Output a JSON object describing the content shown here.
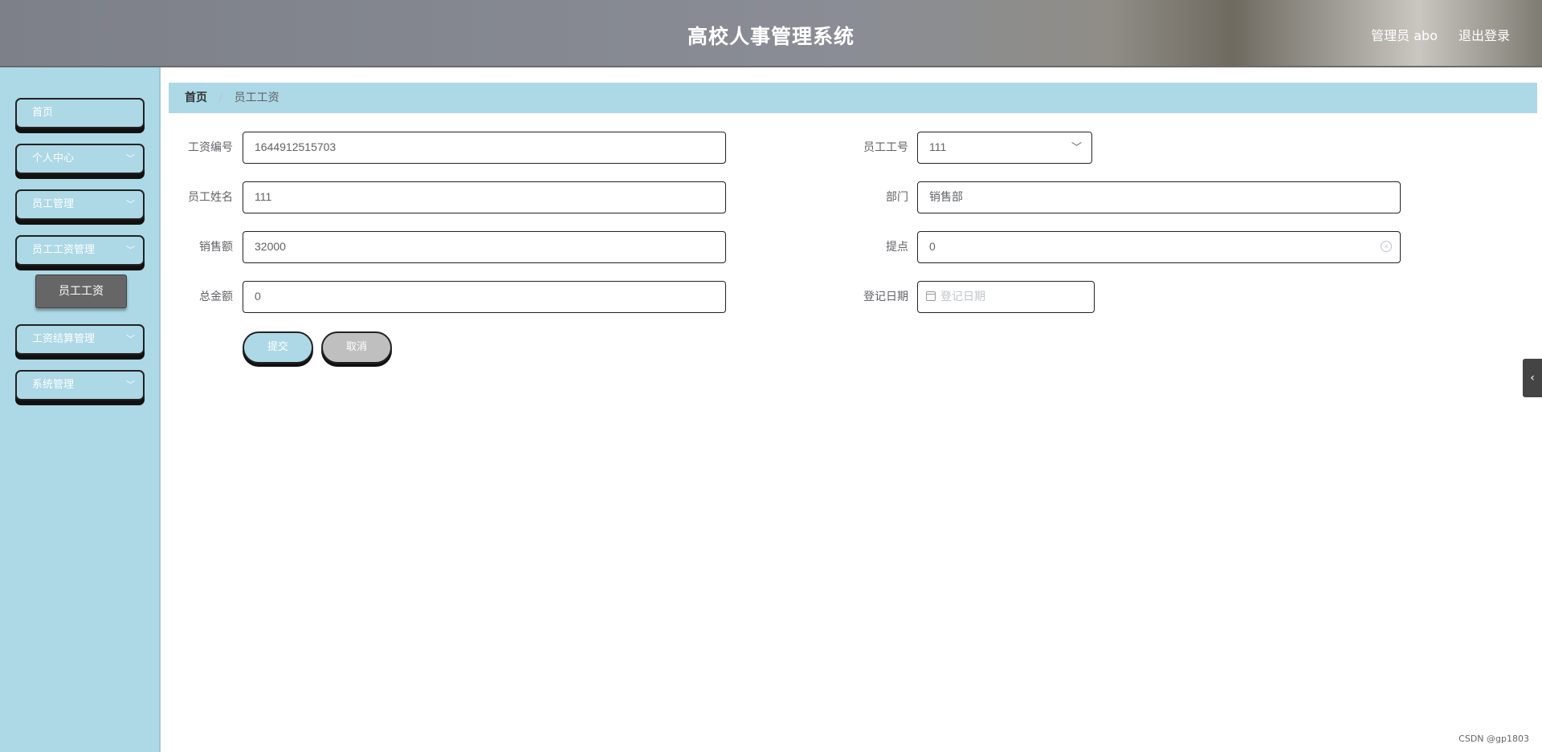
{
  "header": {
    "title": "高校人事管理系统",
    "user": "管理员 abo",
    "logout": "退出登录"
  },
  "sidebar": {
    "items": [
      {
        "label": "首页",
        "has_children": false
      },
      {
        "label": "个人中心",
        "has_children": true
      },
      {
        "label": "员工管理",
        "has_children": true
      },
      {
        "label": "员工工资管理",
        "has_children": true
      },
      {
        "label": "工资结算管理",
        "has_children": true
      },
      {
        "label": "系统管理",
        "has_children": true
      }
    ],
    "sub_item": "员工工资",
    "chevron_icon": "chevron-down-icon"
  },
  "breadcrumb": {
    "home": "首页",
    "separator": "/",
    "current": "员工工资"
  },
  "form": {
    "salary_no": {
      "label": "工资编号",
      "value": "1644912515703"
    },
    "employee_no": {
      "label": "员工工号",
      "value": "111"
    },
    "employee_name": {
      "label": "员工姓名",
      "value": "111"
    },
    "department": {
      "label": "部门",
      "value": "销售部"
    },
    "sales": {
      "label": "销售额",
      "value": "32000"
    },
    "commission": {
      "label": "提点",
      "value": "0"
    },
    "total": {
      "label": "总金额",
      "value": "0"
    },
    "register_date": {
      "label": "登记日期",
      "placeholder": "登记日期"
    }
  },
  "buttons": {
    "submit": "提交",
    "cancel": "取消"
  },
  "edge_toggle": "‹",
  "watermark": "CSDN @gp1803",
  "colors": {
    "accent": "#add8e6",
    "submenu": "#666666",
    "cancel": "#c0bfc0"
  }
}
